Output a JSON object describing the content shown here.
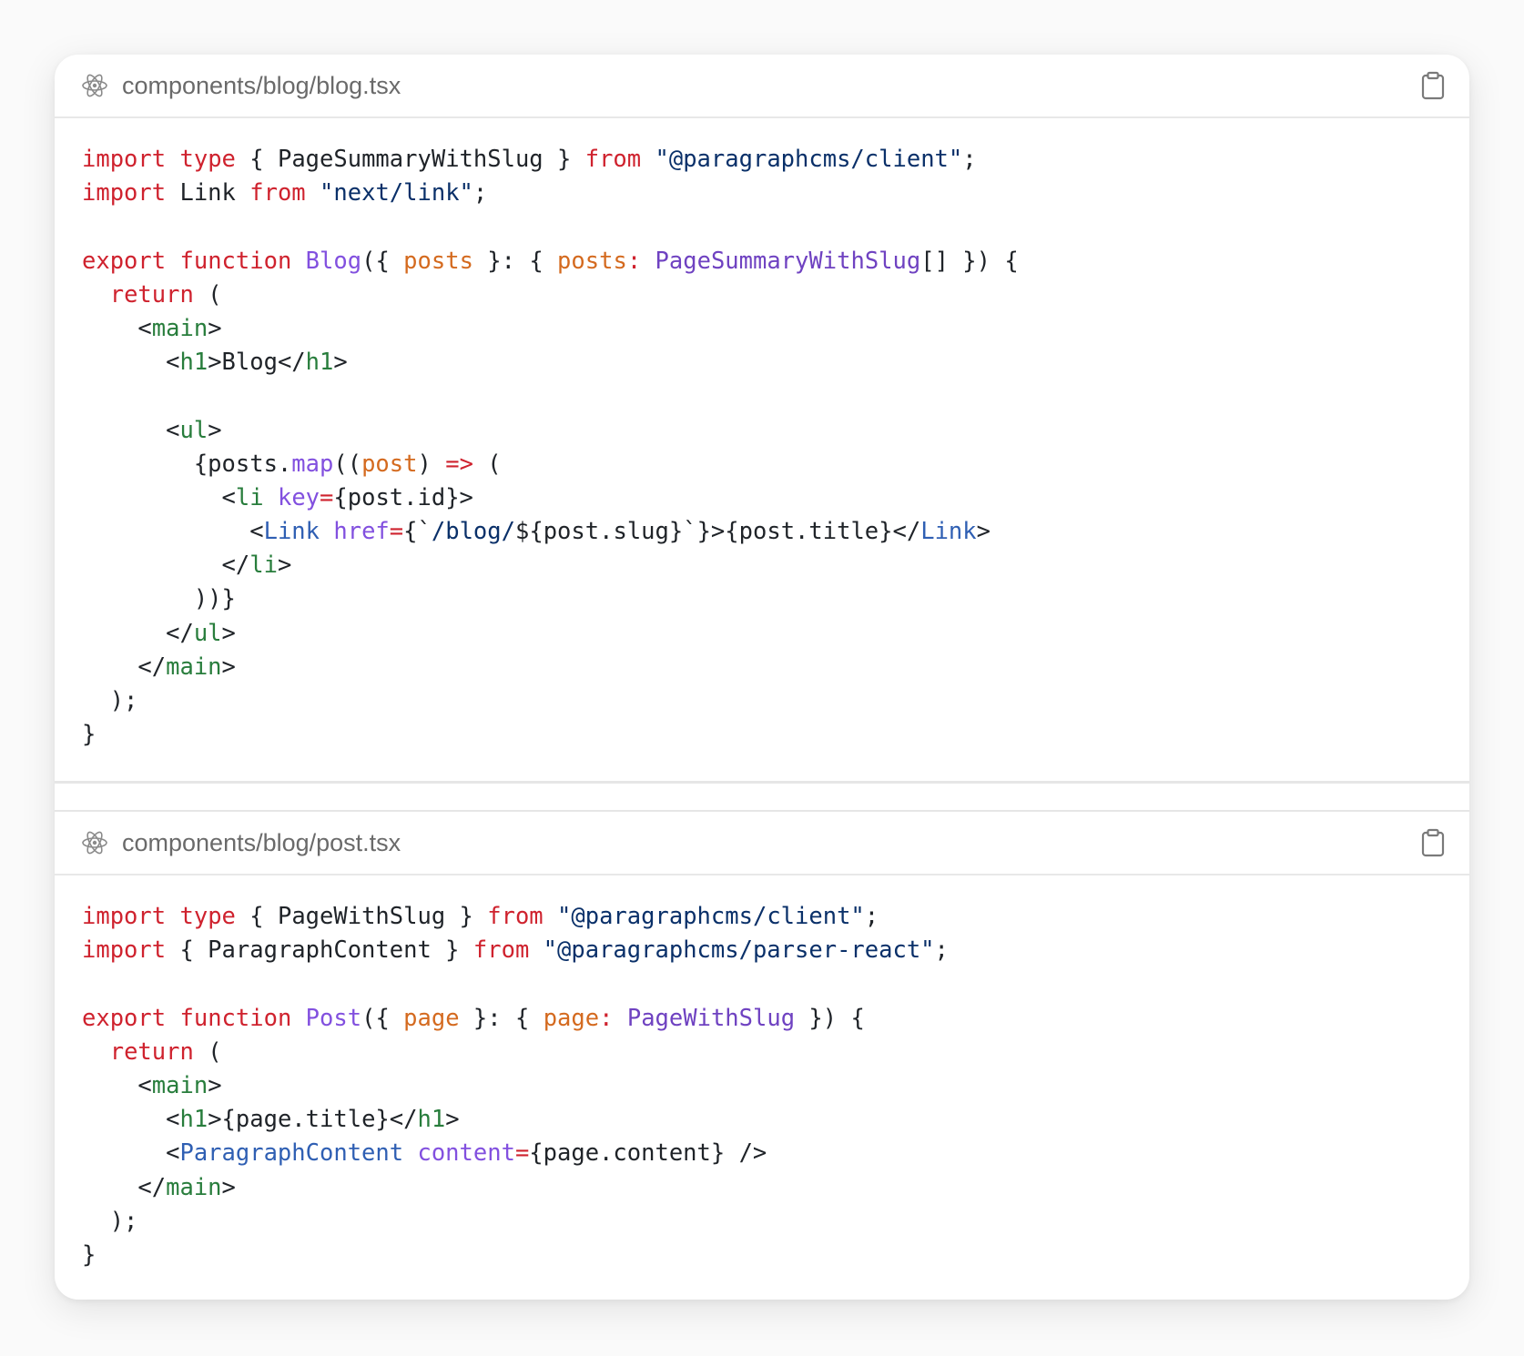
{
  "files": [
    {
      "filename": "components/blog/blog.tsx",
      "lines": [
        [
          [
            "k",
            "import"
          ],
          [
            "n",
            " "
          ],
          [
            "k",
            "type"
          ],
          [
            "n",
            " { PageSummaryWithSlug } "
          ],
          [
            "k",
            "from"
          ],
          [
            "n",
            " "
          ],
          [
            "s",
            "\"@paragraphcms/client\""
          ],
          [
            "n",
            ";"
          ]
        ],
        [
          [
            "k",
            "import"
          ],
          [
            "n",
            " Link "
          ],
          [
            "k",
            "from"
          ],
          [
            "n",
            " "
          ],
          [
            "s",
            "\"next/link\""
          ],
          [
            "n",
            ";"
          ]
        ],
        [],
        [
          [
            "k",
            "export"
          ],
          [
            "n",
            " "
          ],
          [
            "k",
            "function"
          ],
          [
            "n",
            " "
          ],
          [
            "f",
            "Blog"
          ],
          [
            "n",
            "({ "
          ],
          [
            "p",
            "posts"
          ],
          [
            "n",
            " }: { "
          ],
          [
            "p",
            "posts"
          ],
          [
            "k",
            ":"
          ],
          [
            "n",
            " "
          ],
          [
            "t",
            "PageSummaryWithSlug"
          ],
          [
            "n",
            "[] }) {"
          ]
        ],
        [
          [
            "n",
            "  "
          ],
          [
            "k",
            "return"
          ],
          [
            "n",
            " ("
          ]
        ],
        [
          [
            "n",
            "    <"
          ],
          [
            "g",
            "main"
          ],
          [
            "n",
            ">"
          ]
        ],
        [
          [
            "n",
            "      <"
          ],
          [
            "g",
            "h1"
          ],
          [
            "n",
            ">Blog</"
          ],
          [
            "g",
            "h1"
          ],
          [
            "n",
            ">"
          ]
        ],
        [],
        [
          [
            "n",
            "      <"
          ],
          [
            "g",
            "ul"
          ],
          [
            "n",
            ">"
          ]
        ],
        [
          [
            "n",
            "        {posts."
          ],
          [
            "f",
            "map"
          ],
          [
            "n",
            "(("
          ],
          [
            "p",
            "post"
          ],
          [
            "n",
            ") "
          ],
          [
            "k",
            "=>"
          ],
          [
            "n",
            " ("
          ]
        ],
        [
          [
            "n",
            "          <"
          ],
          [
            "g",
            "li"
          ],
          [
            "n",
            " "
          ],
          [
            "f",
            "key"
          ],
          [
            "k",
            "="
          ],
          [
            "n",
            "{post.id}>"
          ]
        ],
        [
          [
            "n",
            "            <"
          ],
          [
            "b",
            "Link"
          ],
          [
            "n",
            " "
          ],
          [
            "f",
            "href"
          ],
          [
            "k",
            "="
          ],
          [
            "n",
            "{`"
          ],
          [
            "s",
            "/blog/"
          ],
          [
            "n",
            "${post.slug}`}>{post.title}</"
          ],
          [
            "b",
            "Link"
          ],
          [
            "n",
            ">"
          ]
        ],
        [
          [
            "n",
            "          </"
          ],
          [
            "g",
            "li"
          ],
          [
            "n",
            ">"
          ]
        ],
        [
          [
            "n",
            "        ))}"
          ]
        ],
        [
          [
            "n",
            "      </"
          ],
          [
            "g",
            "ul"
          ],
          [
            "n",
            ">"
          ]
        ],
        [
          [
            "n",
            "    </"
          ],
          [
            "g",
            "main"
          ],
          [
            "n",
            ">"
          ]
        ],
        [
          [
            "n",
            "  );"
          ]
        ],
        [
          [
            "n",
            "}"
          ]
        ]
      ]
    },
    {
      "filename": "components/blog/post.tsx",
      "lines": [
        [
          [
            "k",
            "import"
          ],
          [
            "n",
            " "
          ],
          [
            "k",
            "type"
          ],
          [
            "n",
            " { PageWithSlug } "
          ],
          [
            "k",
            "from"
          ],
          [
            "n",
            " "
          ],
          [
            "s",
            "\"@paragraphcms/client\""
          ],
          [
            "n",
            ";"
          ]
        ],
        [
          [
            "k",
            "import"
          ],
          [
            "n",
            " { ParagraphContent } "
          ],
          [
            "k",
            "from"
          ],
          [
            "n",
            " "
          ],
          [
            "s",
            "\"@paragraphcms/parser-react\""
          ],
          [
            "n",
            ";"
          ]
        ],
        [],
        [
          [
            "k",
            "export"
          ],
          [
            "n",
            " "
          ],
          [
            "k",
            "function"
          ],
          [
            "n",
            " "
          ],
          [
            "f",
            "Post"
          ],
          [
            "n",
            "({ "
          ],
          [
            "p",
            "page"
          ],
          [
            "n",
            " }: { "
          ],
          [
            "p",
            "page"
          ],
          [
            "k",
            ":"
          ],
          [
            "n",
            " "
          ],
          [
            "t",
            "PageWithSlug"
          ],
          [
            "n",
            " }) {"
          ]
        ],
        [
          [
            "n",
            "  "
          ],
          [
            "k",
            "return"
          ],
          [
            "n",
            " ("
          ]
        ],
        [
          [
            "n",
            "    <"
          ],
          [
            "g",
            "main"
          ],
          [
            "n",
            ">"
          ]
        ],
        [
          [
            "n",
            "      <"
          ],
          [
            "g",
            "h1"
          ],
          [
            "n",
            ">{page.title}</"
          ],
          [
            "g",
            "h1"
          ],
          [
            "n",
            ">"
          ]
        ],
        [
          [
            "n",
            "      <"
          ],
          [
            "b",
            "ParagraphContent"
          ],
          [
            "n",
            " "
          ],
          [
            "f",
            "content"
          ],
          [
            "k",
            "="
          ],
          [
            "n",
            "{page.content} />"
          ]
        ],
        [
          [
            "n",
            "    </"
          ],
          [
            "g",
            "main"
          ],
          [
            "n",
            ">"
          ]
        ],
        [
          [
            "n",
            "  );"
          ]
        ],
        [
          [
            "n",
            "}"
          ]
        ]
      ]
    }
  ],
  "icons": {
    "file_icon": "react-atom-icon",
    "copy_icon": "clipboard-icon"
  },
  "colors": {
    "keyword": "#cf222e",
    "string": "#0a3069",
    "param": "#d46a1f",
    "function": "#8250df",
    "type": "#6f42c1",
    "tag": "#287d3c",
    "component": "#2f5fb3",
    "text": "#1f2328"
  }
}
